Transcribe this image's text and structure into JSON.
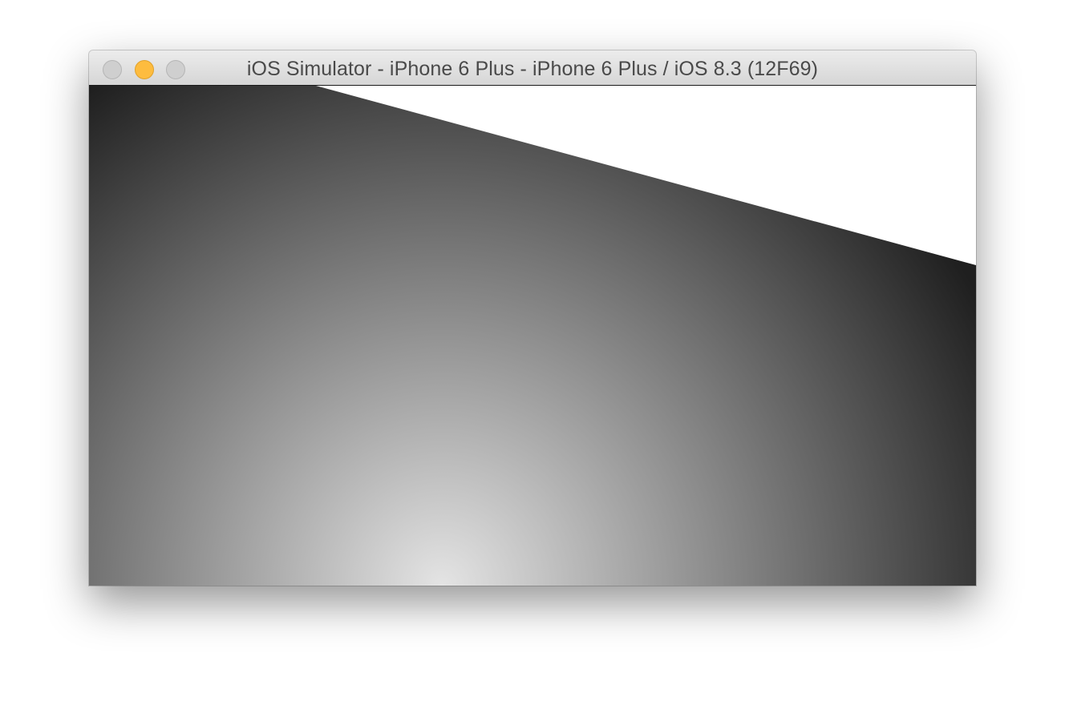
{
  "window": {
    "title": "iOS Simulator - iPhone 6 Plus - iPhone 6 Plus / iOS 8.3 (12F69)",
    "buttons": [
      {
        "name": "close",
        "color": "#cfcfcf"
      },
      {
        "name": "minimize",
        "color": "#fdbc3f"
      },
      {
        "name": "zoom",
        "color": "#cfcfcf"
      }
    ]
  },
  "screen": {
    "background_color": "#ffffff",
    "gradient_shape": {
      "dark_color": "#1f1f1f",
      "light_color": "#e4e4e4"
    }
  }
}
